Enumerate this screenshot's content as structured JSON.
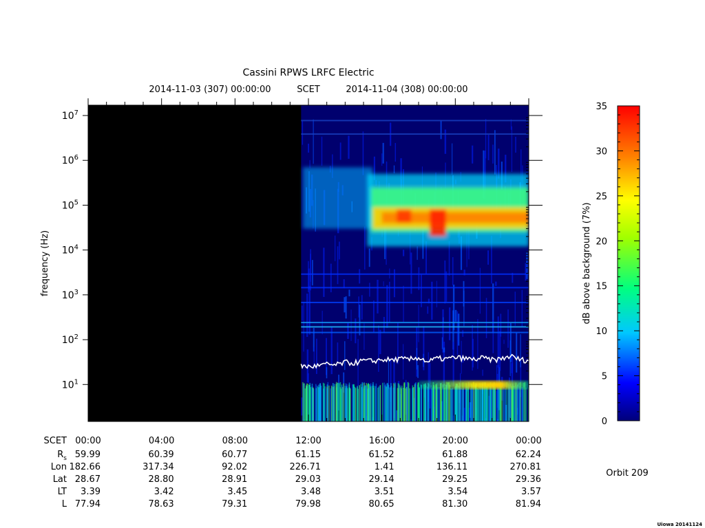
{
  "header": {
    "title": "Cassini RPWS LRFC Electric",
    "start_time": "2014-11-03 (307) 00:00:00",
    "scet_label": "SCET",
    "end_time": "2014-11-04 (308) 00:00:00"
  },
  "y_axis": {
    "label": "frequency (Hz)",
    "ticks": [
      {
        "base": "10",
        "exp": "1",
        "value": 10
      },
      {
        "base": "10",
        "exp": "2",
        "value": 100
      },
      {
        "base": "10",
        "exp": "3",
        "value": 1000
      },
      {
        "base": "10",
        "exp": "4",
        "value": 10000
      },
      {
        "base": "10",
        "exp": "5",
        "value": 100000
      },
      {
        "base": "10",
        "exp": "6",
        "value": 1000000
      },
      {
        "base": "10",
        "exp": "7",
        "value": 10000000
      }
    ]
  },
  "colorbar": {
    "label": "dB above background (7%)",
    "ticks": [
      "0",
      "5",
      "10",
      "15",
      "20",
      "25",
      "30",
      "35"
    ]
  },
  "ephemeris": {
    "row_labels": [
      "SCET",
      "Rs",
      "Lon",
      "Lat",
      "LT",
      "L"
    ],
    "rs_main": "R",
    "rs_sub": "s",
    "columns": [
      {
        "time": "00:00",
        "rs": "59.99",
        "lon": "182.66",
        "lat": "28.67",
        "lt": "3.39",
        "l": "77.94"
      },
      {
        "time": "04:00",
        "rs": "60.39",
        "lon": "317.34",
        "lat": "28.80",
        "lt": "3.42",
        "l": "78.63"
      },
      {
        "time": "08:00",
        "rs": "60.77",
        "lon": "92.02",
        "lat": "28.91",
        "lt": "3.45",
        "l": "79.31"
      },
      {
        "time": "12:00",
        "rs": "61.15",
        "lon": "226.71",
        "lat": "29.03",
        "lt": "3.48",
        "l": "79.98"
      },
      {
        "time": "16:00",
        "rs": "61.52",
        "lon": "1.41",
        "lat": "29.14",
        "lt": "3.51",
        "l": "80.65"
      },
      {
        "time": "20:00",
        "rs": "61.88",
        "lon": "136.11",
        "lat": "29.25",
        "lt": "3.54",
        "l": "81.30"
      },
      {
        "time": "00:00",
        "rs": "62.24",
        "lon": "270.81",
        "lat": "29.36",
        "lt": "3.57",
        "l": "81.94"
      }
    ]
  },
  "orbit": "Orbit 209",
  "footer": "Uiowa 20141124",
  "chart_data": {
    "type": "heatmap",
    "title": "Cassini RPWS LRFC Electric",
    "xlabel": "SCET",
    "ylabel": "frequency (Hz)",
    "x_range": [
      "2014-11-03 00:00",
      "2014-11-04 00:00"
    ],
    "y_range_hz": [
      1.5,
      17000000
    ],
    "y_scale": "log",
    "z_label": "dB above background (7%)",
    "z_range": [
      0,
      35
    ],
    "data_gap": {
      "start": "00:00",
      "end": "11:30"
    },
    "features": [
      {
        "name_shown": false,
        "type": "auroral kilometric radiation band",
        "time_range": [
          "15:30",
          "24:00"
        ],
        "freq_range_hz": [
          15000,
          1000000
        ],
        "peak_db": 35,
        "peak_freq_hz": 50000
      },
      {
        "name_shown": false,
        "type": "low frequency band",
        "time_range": [
          "18:00",
          "24:00"
        ],
        "freq_range_hz": [
          8,
          12
        ],
        "peak_db": 30
      }
    ],
    "electron_cyclotron_line": {
      "color": "#ffffff",
      "time_hr": [
        11.6,
        12.0,
        12.5,
        13.0,
        13.5,
        14.0,
        14.5,
        15.0,
        15.5,
        16.0,
        16.5,
        17.0,
        17.5,
        18.0,
        18.5,
        19.0,
        19.5,
        20.0,
        20.5,
        21.0,
        21.5,
        22.0,
        22.5,
        23.0,
        23.5,
        24.0
      ],
      "freq_hz": [
        26,
        25,
        26,
        28,
        27,
        31,
        30,
        34,
        33,
        36,
        35,
        37,
        36,
        40,
        32,
        38,
        37,
        40,
        38,
        36,
        39,
        35,
        37,
        43,
        36,
        34
      ]
    }
  }
}
